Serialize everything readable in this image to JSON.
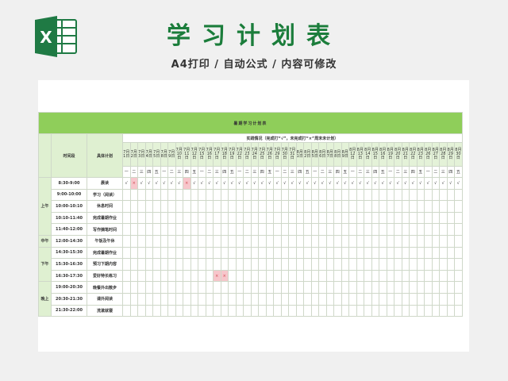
{
  "page": {
    "title": "学习计划表",
    "subtitle": "A4打印 / 自动公式 / 内容可修改",
    "logo_icon": "excel-icon",
    "accent_color": "#1b7d3b",
    "logo_color": "#1f7a44"
  },
  "sheet": {
    "banner": "暑期学习计划表",
    "header_period": "时间段",
    "header_plan": "具体计划",
    "header_note": "实践情况（完成打“√”，未完成打“×”周末未计划）",
    "banner_color": "#8fce5a",
    "miss_color": "#f7c6cb",
    "dates": [
      "7月1日",
      "7月2日",
      "7月3日",
      "7月4日",
      "7月5日",
      "7月8日",
      "7月9日",
      "7月10日",
      "7月11日",
      "7月12日",
      "7月15日",
      "7月16日",
      "7月17日",
      "7月18日",
      "7月19日",
      "7月22日",
      "7月23日",
      "7月24日",
      "7月25日",
      "7月26日",
      "7月29日",
      "7月30日",
      "7月31日",
      "8月1日",
      "8月2日",
      "8月5日",
      "8月6日",
      "8月7日",
      "8月8日",
      "8月9日",
      "8月12日",
      "8月13日",
      "8月14日",
      "8月15日",
      "8月16日",
      "8月19日",
      "8月20日",
      "8月21日",
      "8月22日",
      "8月23日",
      "8月26日",
      "8月27日",
      "8月28日",
      "8月29日",
      "8月30日"
    ],
    "days": [
      "一",
      "二",
      "三",
      "四",
      "五",
      "一",
      "二",
      "三",
      "四",
      "五",
      "一",
      "二",
      "三",
      "四",
      "五",
      "一",
      "二",
      "三",
      "四",
      "五",
      "一",
      "二",
      "三",
      "四",
      "五",
      "一",
      "二",
      "三",
      "四",
      "五",
      "一",
      "二",
      "三",
      "四",
      "五",
      "一",
      "二",
      "三",
      "四",
      "五",
      "一",
      "二",
      "三",
      "四",
      "五"
    ],
    "periods": [
      {
        "name": "上午",
        "span": 5
      },
      {
        "name": "中午",
        "span": 1
      },
      {
        "name": "下午",
        "span": 3
      },
      {
        "name": "晚上",
        "span": 3
      }
    ],
    "rows": [
      {
        "time": "8:30-9:00",
        "plan": "晨读",
        "marks": [
          "√",
          "×",
          "√",
          "√",
          "√",
          "√",
          "√",
          "√",
          "×",
          "√",
          "√",
          "√",
          "√",
          "√",
          "√",
          "√",
          "√",
          "√",
          "√",
          "√",
          "√",
          "√",
          "√",
          "√",
          "√",
          "√",
          "√",
          "√",
          "√",
          "√",
          "√",
          "√",
          "√",
          "√",
          "√",
          "√",
          "√",
          "√",
          "√",
          "√",
          "√",
          "√",
          "√",
          "√",
          "√"
        ]
      },
      {
        "time": "9:00-10:00",
        "plan": "学习（阅读）",
        "marks": []
      },
      {
        "time": "10:00-10:10",
        "plan": "休息时间",
        "marks": []
      },
      {
        "time": "10:10-11:40",
        "plan": "完成暑期作业",
        "marks": []
      },
      {
        "time": "11:40-12:00",
        "plan": "写作摘笔时间",
        "marks": []
      },
      {
        "time": "12:00-14:30",
        "plan": "午饭及午休",
        "marks": []
      },
      {
        "time": "14:30-15:30",
        "plan": "完成暑期作业",
        "marks": []
      },
      {
        "time": "15:30-16:30",
        "plan": "预习下期内容",
        "marks": []
      },
      {
        "time": "16:30-17:30",
        "plan": "爱好特长练习",
        "marks": [
          "",
          "",
          "",
          "",
          "",
          "",
          "",
          "",
          "",
          "",
          "",
          "",
          "×",
          "×",
          "",
          "",
          "",
          "",
          "",
          "",
          "",
          "",
          "",
          "",
          "",
          "",
          "",
          "",
          "",
          "",
          "",
          "",
          "",
          "",
          "",
          "",
          "",
          "",
          "",
          "",
          "",
          "",
          "",
          "",
          ""
        ]
      },
      {
        "time": "19:00-20:30",
        "plan": "晚餐外出散步",
        "marks": []
      },
      {
        "time": "20:30-21:30",
        "plan": "课外阅读",
        "marks": []
      },
      {
        "time": "21:30-22:00",
        "plan": "洗漱就寝",
        "marks": []
      }
    ]
  }
}
